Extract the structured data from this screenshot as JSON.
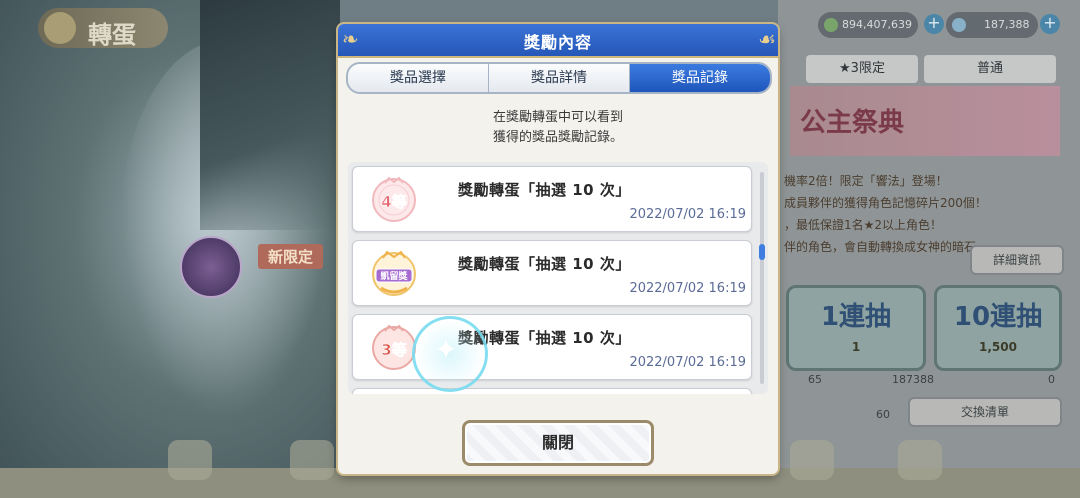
{
  "background": {
    "screen_title": "轉蛋",
    "currency_1": "894,407,639",
    "currency_2": "187,388",
    "tabs": [
      "★3限定",
      "普通"
    ],
    "banner_text": "公主祭典",
    "info_lines": [
      "機率2倍！限定「響法」登場！",
      "成員夥伴的獲得角色記憶碎片200個！",
      "，最低保證1名★2以上角色！",
      "伴的角色，會自動轉換成女神的暗石。"
    ],
    "detail_button": "詳細資訊",
    "single_pull": {
      "label": "1連抽",
      "cost": "1"
    },
    "ten_pull": {
      "label": "10連抽",
      "cost": "1,500"
    },
    "stats": [
      "65",
      "187388",
      "0",
      "60"
    ],
    "exchange_button": "交換清單",
    "new_limited_tag": "新限定"
  },
  "modal": {
    "title": "獎勵內容",
    "tabs": [
      {
        "label": "獎品選擇",
        "active": false
      },
      {
        "label": "獎品詳情",
        "active": false
      },
      {
        "label": "獎品記錄",
        "active": true
      }
    ],
    "description_line1": "在獎勵轉蛋中可以看到",
    "description_line2": "獲得的獎品獎勵記錄。",
    "records": [
      {
        "prize_icon": "prize-4th-icon",
        "prize_badge": "4等",
        "name": "獎勵轉蛋「抽選 10 次」",
        "time": "2022/07/02 16:19"
      },
      {
        "prize_icon": "prize-kyaru-icon",
        "prize_badge": "凱留獎",
        "name": "獎勵轉蛋「抽選 10 次」",
        "time": "2022/07/02 16:19"
      },
      {
        "prize_icon": "prize-3rd-icon",
        "prize_badge": "3等",
        "name": "獎勵轉蛋「抽選 10 次」",
        "time": "2022/07/02 16:19"
      }
    ],
    "close_button": "關閉"
  },
  "colors": {
    "header_blue": "#2557b8",
    "active_tab_blue": "#1f56bb",
    "timestamp": "#5a6b96",
    "gold_border": "#c9b585"
  }
}
